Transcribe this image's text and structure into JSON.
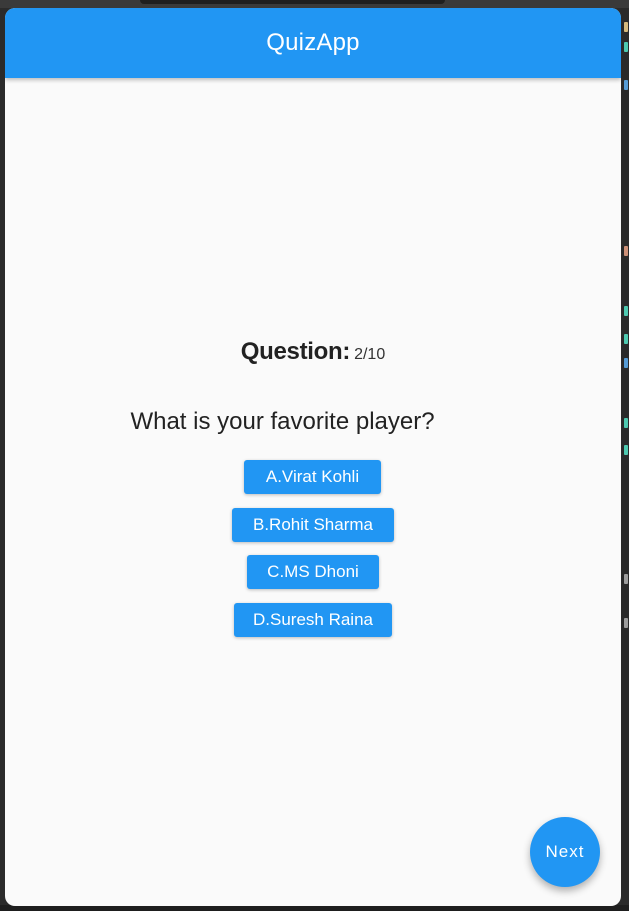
{
  "app_bar": {
    "title": "QuizApp"
  },
  "question": {
    "label": "Question:",
    "count": "2/10",
    "text": "What is your favorite player?"
  },
  "options": [
    {
      "label": "A.Virat Kohli"
    },
    {
      "label": "B.Rohit Sharma"
    },
    {
      "label": "C.MS Dhoni"
    },
    {
      "label": "D.Suresh Raina"
    }
  ],
  "fab": {
    "label": "Next"
  },
  "colors": {
    "primary": "#2196f3",
    "background": "#fafafa",
    "desktop": "#2b2b2b",
    "text": "#222222"
  }
}
